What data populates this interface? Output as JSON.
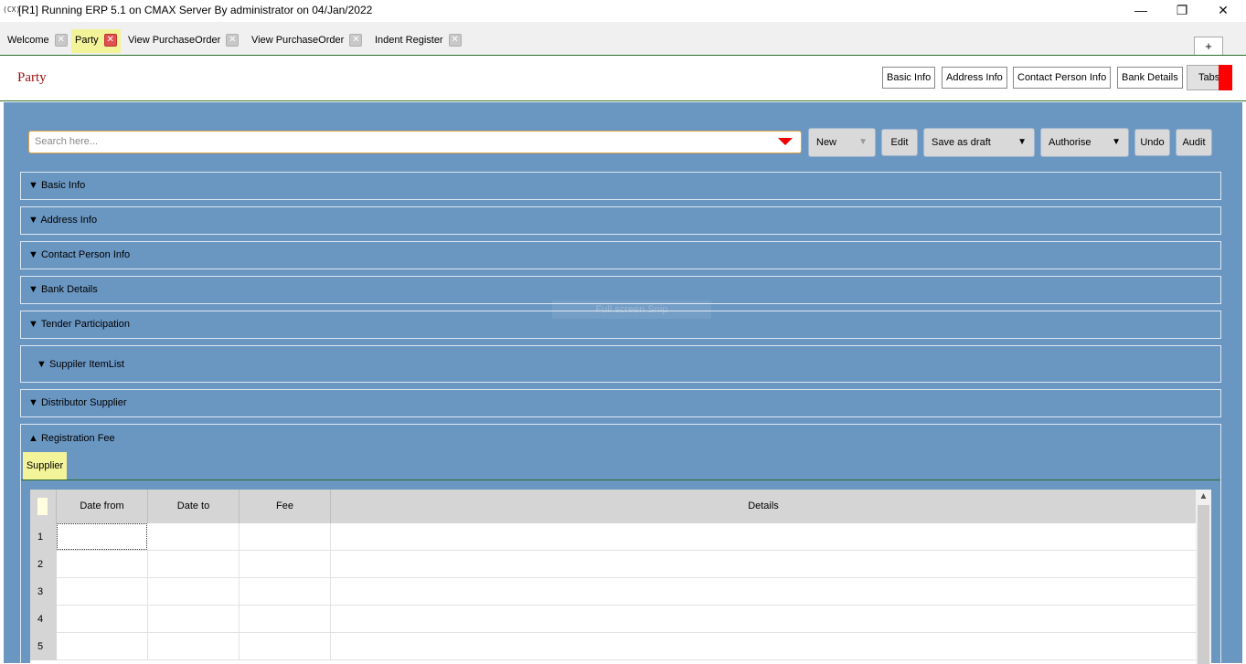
{
  "window": {
    "app_icon": "(CX)",
    "title": "[R1] Running ERP 5.1 on CMAX Server By administrator on 04/Jan/2022",
    "controls": {
      "minimize": "—",
      "restore": "❐",
      "close": "✕"
    }
  },
  "tabs": [
    {
      "label": "Welcome",
      "close": "✕"
    },
    {
      "label": "Party",
      "close": "✕"
    },
    {
      "label": "View PurchaseOrder",
      "close": "✕"
    },
    {
      "label": "View PurchaseOrder",
      "close": "✕"
    },
    {
      "label": "Indent Register",
      "close": "✕"
    }
  ],
  "new_tab_label": "+",
  "header": {
    "title": "Party",
    "buttons": [
      "Basic Info",
      "Address Info",
      "Contact Person Info",
      "Bank Details"
    ],
    "tabs_button": "Tabs"
  },
  "toolbar": {
    "search_placeholder": "Search here...",
    "new_label": "New",
    "new_arrow": "▼",
    "edit_label": "Edit",
    "save_label": "Save as draft",
    "save_arrow": "▼",
    "authorise_label": "Authorise",
    "authorise_arrow": "▼",
    "undo_label": "Undo",
    "audit_label": "Audit"
  },
  "sections": [
    {
      "arrow": "▼",
      "label": "Basic Info"
    },
    {
      "arrow": "▼",
      "label": "Address Info"
    },
    {
      "arrow": "▼",
      "label": "Contact Person Info"
    },
    {
      "arrow": "▼",
      "label": "Bank Details"
    },
    {
      "arrow": "▼",
      "label": "Tender Participation"
    },
    {
      "arrow": "▼",
      "label": "Suppiler ItemList"
    },
    {
      "arrow": "▼",
      "label": "Distributor Supplier"
    },
    {
      "arrow": "▲",
      "label": "Registration Fee"
    }
  ],
  "watermark": "Full screen Snip",
  "registration": {
    "subtab": "Supplier",
    "columns": [
      "Date from",
      "Date to",
      "Fee",
      "Details"
    ],
    "rows": [
      "1",
      "2",
      "3",
      "4",
      "5"
    ],
    "scroll_up": "▲"
  }
}
